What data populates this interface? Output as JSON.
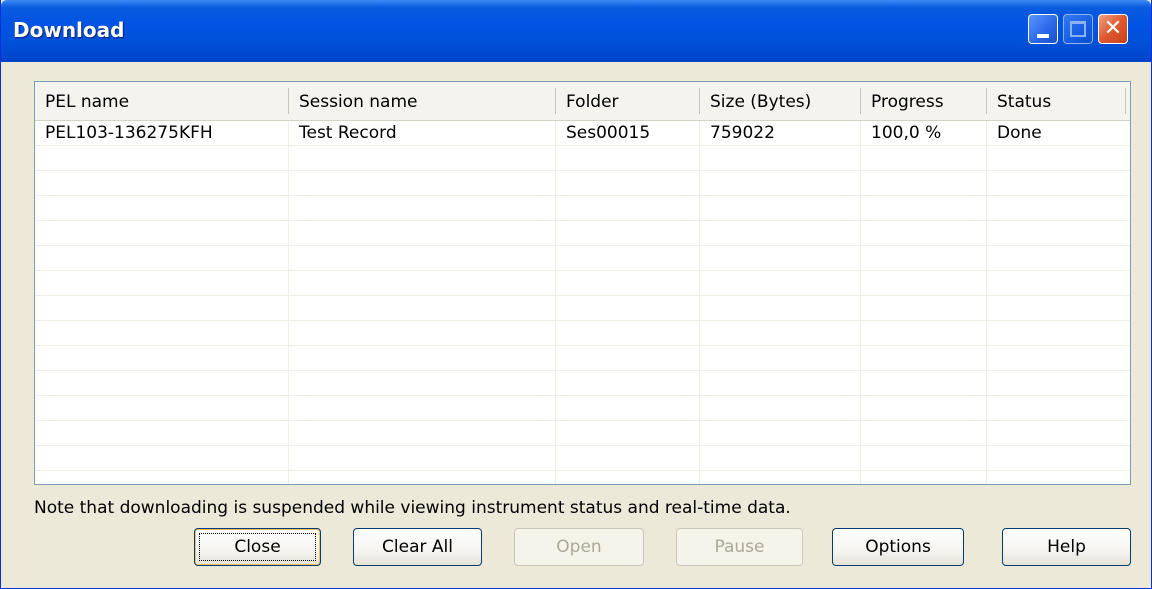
{
  "window": {
    "title": "Download"
  },
  "table": {
    "columns": [
      "PEL name",
      "Session name",
      "Folder",
      "Size (Bytes)",
      "Progress",
      "Status"
    ],
    "rows": [
      [
        "PEL103-136275KFH",
        "Test Record",
        "Ses00015",
        "759022",
        "100,0 %",
        "Done"
      ]
    ]
  },
  "note": "Note that downloading is suspended while viewing instrument status and real-time data.",
  "buttons": {
    "close": "Close",
    "clear_all": "Clear All",
    "open": "Open",
    "pause": "Pause",
    "options": "Options",
    "help": "Help"
  },
  "colors": {
    "title_bar": "#0054E3",
    "window_face": "#ECE9D8",
    "close_button": "#E0582E"
  }
}
